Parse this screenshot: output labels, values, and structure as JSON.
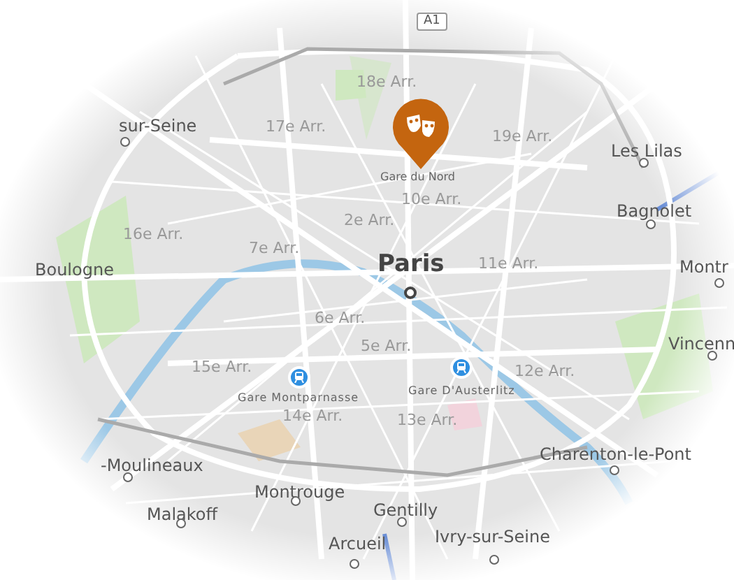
{
  "map": {
    "places": [
      {
        "kind": "shield",
        "label": "A1"
      },
      {
        "kind": "district",
        "label": "18e Arr."
      },
      {
        "kind": "town",
        "label": "sur-Seine"
      },
      {
        "kind": "district",
        "label": "17e Arr."
      },
      {
        "kind": "district",
        "label": "19e Arr."
      },
      {
        "kind": "town",
        "label": "Les Lilas"
      },
      {
        "kind": "poi",
        "label": "Gare du Nord"
      },
      {
        "kind": "district",
        "label": "10e Arr."
      },
      {
        "kind": "district",
        "label": "2e Arr."
      },
      {
        "kind": "town",
        "label": "Bagnolet"
      },
      {
        "kind": "district",
        "label": "16e Arr."
      },
      {
        "kind": "town",
        "label": "Boulogne"
      },
      {
        "kind": "district",
        "label": "7e Arr."
      },
      {
        "kind": "capital",
        "label": "Paris"
      },
      {
        "kind": "district",
        "label": "11e Arr."
      },
      {
        "kind": "town",
        "label": "Montr"
      },
      {
        "kind": "district",
        "label": "6e Arr."
      },
      {
        "kind": "district",
        "label": "5e Arr."
      },
      {
        "kind": "district",
        "label": "15e Arr."
      },
      {
        "kind": "town",
        "label": "Vincenn"
      },
      {
        "kind": "district",
        "label": "12e Arr."
      },
      {
        "kind": "station",
        "label": "Gare Montparnasse"
      },
      {
        "kind": "station",
        "label": "Gare D'Austerlitz"
      },
      {
        "kind": "district",
        "label": "14e Arr."
      },
      {
        "kind": "district",
        "label": "13e Arr."
      },
      {
        "kind": "town",
        "label": "Charenton-le-Pont"
      },
      {
        "kind": "town",
        "label": "-Moulineaux"
      },
      {
        "kind": "town",
        "label": "Montrouge"
      },
      {
        "kind": "town",
        "label": "Malakoff"
      },
      {
        "kind": "town",
        "label": "Gentilly"
      },
      {
        "kind": "town",
        "label": "Arcueil"
      },
      {
        "kind": "town",
        "label": "Ivry-sur-Seine"
      }
    ],
    "pin": {
      "kind": "theater"
    }
  }
}
